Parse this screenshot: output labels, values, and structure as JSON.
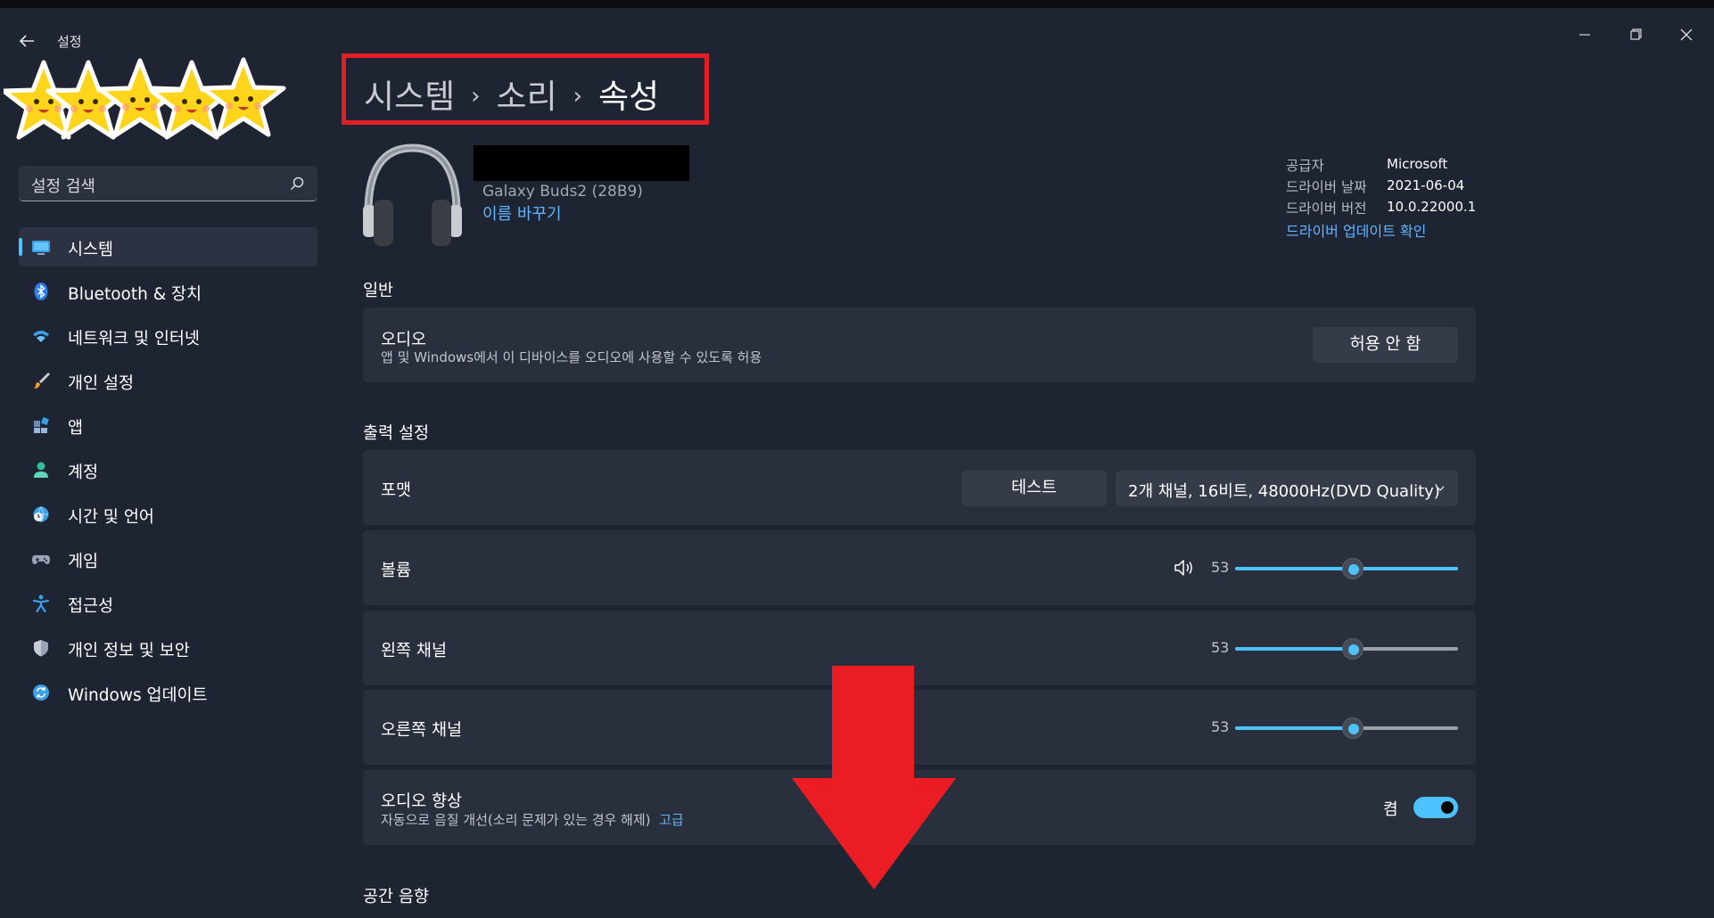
{
  "window": {
    "title": "설정",
    "controls": [
      "minimize",
      "maximize",
      "close"
    ]
  },
  "overlay": {
    "rating_stars": 5
  },
  "sidebar": {
    "search_placeholder": "설정 검색",
    "items": [
      {
        "label": "시스템",
        "icon": "system-icon",
        "active": true
      },
      {
        "label": "Bluetooth & 장치",
        "icon": "bluetooth-icon"
      },
      {
        "label": "네트워크 및 인터넷",
        "icon": "wifi-icon"
      },
      {
        "label": "개인 설정",
        "icon": "paintbrush-icon"
      },
      {
        "label": "앱",
        "icon": "apps-icon"
      },
      {
        "label": "계정",
        "icon": "account-icon"
      },
      {
        "label": "시간 및 언어",
        "icon": "globe-clock-icon"
      },
      {
        "label": "게임",
        "icon": "gamepad-icon"
      },
      {
        "label": "접근성",
        "icon": "accessibility-icon"
      },
      {
        "label": "개인 정보 및 보안",
        "icon": "shield-icon"
      },
      {
        "label": "Windows 업데이트",
        "icon": "update-icon"
      }
    ]
  },
  "breadcrumb": {
    "level1": "시스템",
    "level2": "소리",
    "level3": "속성",
    "separator": "›"
  },
  "device": {
    "model": "Galaxy Buds2 (28B9)",
    "rename_label": "이름 바꾸기"
  },
  "driver": {
    "provider_label": "공급자",
    "provider_value": "Microsoft",
    "date_label": "드라이버 날짜",
    "date_value": "2021-06-04",
    "version_label": "드라이버 버전",
    "version_value": "10.0.22000.1",
    "update_link": "드라이버 업데이트 확인"
  },
  "general": {
    "heading": "일반",
    "audio_title": "오디오",
    "audio_desc": "앱 및 Windows에서 이 디바이스를 오디오에 사용할 수 있도록 허용",
    "audio_button": "허용 안 함"
  },
  "output": {
    "heading": "출력 설정",
    "format_label": "포맷",
    "test_button": "테스트",
    "format_value": "2개 채널, 16비트, 48000Hz(DVD Quality)",
    "volume_label": "볼륨",
    "volume_value": "53",
    "left_label": "왼쪽 채널",
    "left_value": "53",
    "right_label": "오른쪽 채널",
    "right_value": "53",
    "enhance_title": "오디오 향상",
    "enhance_desc": "자동으로 음질 개선(소리 문제가 있는 경우 해제)",
    "enhance_link": "고급",
    "enhance_state": "켬"
  },
  "spatial": {
    "heading": "공간 음향"
  },
  "colors": {
    "accent": "#4cc2ff",
    "highlight_box": "#e31e26",
    "arrow": "#ec1c24",
    "background": "#1f2433",
    "card": "#2a2f3d"
  }
}
